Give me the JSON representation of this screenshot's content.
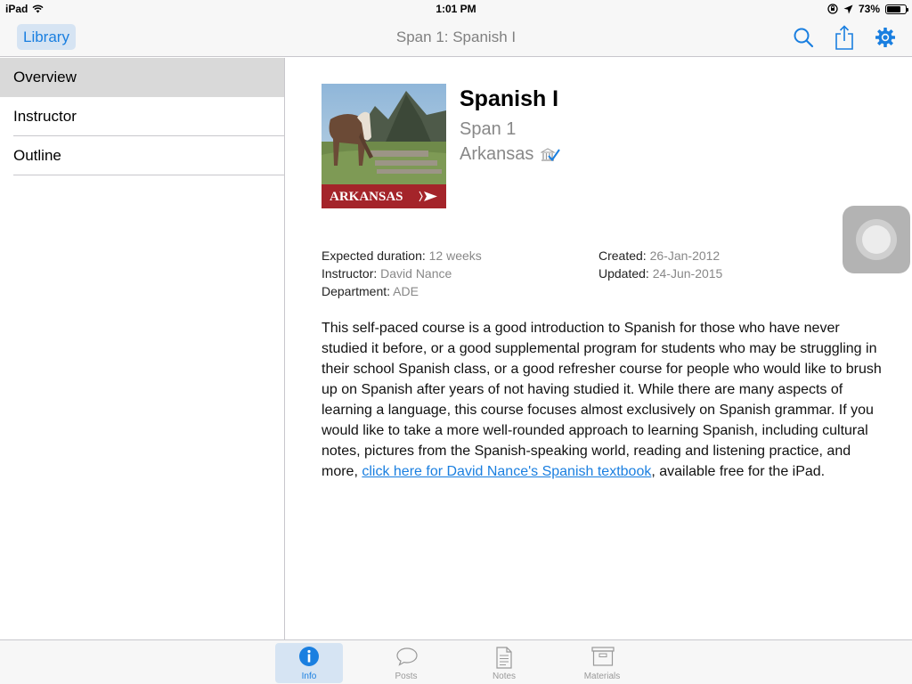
{
  "status": {
    "device": "iPad",
    "time": "1:01 PM",
    "battery": "73%",
    "battery_level": 0.73
  },
  "nav": {
    "back_label": "Library",
    "title": "Span 1: Spanish I",
    "icons": [
      "search-icon",
      "share-icon",
      "gear-icon"
    ]
  },
  "sidebar": {
    "items": [
      {
        "label": "Overview",
        "selected": true
      },
      {
        "label": "Instructor",
        "selected": false
      },
      {
        "label": "Outline",
        "selected": false
      }
    ]
  },
  "course": {
    "cover_banner": "ARKANSAS",
    "title": "Spanish I",
    "code": "Span 1",
    "institution": "Arkansas",
    "meta_left": [
      {
        "key": "Expected duration:",
        "value": "12 weeks"
      },
      {
        "key": "Instructor:",
        "value": "David Nance"
      },
      {
        "key": "Department:",
        "value": "ADE"
      }
    ],
    "meta_right": [
      {
        "key": "Created:",
        "value": "26-Jan-2012"
      },
      {
        "key": "Updated:",
        "value": "24-Jun-2015"
      }
    ],
    "description": "This self-paced course is a good introduction to Spanish for those who have never studied it before, or a good supplemental program for students who may be struggling in their school Spanish class, or a good refresher course for people who would like to brush up on Spanish after years of not having studied it.  While there are many aspects of learning a language, this course focuses almost exclusively on Spanish grammar.  If you would like to take a more well-rounded approach to learning Spanish, including cultural notes, pictures from the Spanish-speaking world, reading and listening practice, and more, ",
    "link_text": "click here for David Nance's Spanish textbook",
    "description_end": ", available free for the iPad."
  },
  "tabs": [
    {
      "label": "Info",
      "icon": "info-icon",
      "active": true
    },
    {
      "label": "Posts",
      "icon": "speech-bubble-icon",
      "active": false
    },
    {
      "label": "Notes",
      "icon": "document-icon",
      "active": false
    },
    {
      "label": "Materials",
      "icon": "archive-box-icon",
      "active": false
    }
  ],
  "colors": {
    "accent": "#1a7fe0",
    "selected_row": "#d9d9d9",
    "bar_background": "#f7f7f7"
  }
}
